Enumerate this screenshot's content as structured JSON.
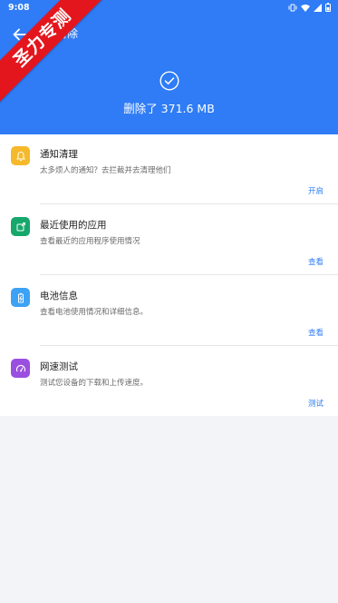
{
  "status_bar": {
    "time": "9:08"
  },
  "header": {
    "title": "清除",
    "result": "删除了 371.6 MB"
  },
  "ribbon": {
    "text": "圣力专测"
  },
  "items": [
    {
      "title": "通知清理",
      "desc": "太多烦人的通知？去拦截并去清理他们",
      "action": "开启",
      "icon": "bell-icon",
      "color": "#f5b92b"
    },
    {
      "title": "最近使用的应用",
      "desc": "查看最近的应用程序使用情况",
      "action": "查看",
      "icon": "recent-apps-icon",
      "color": "#16a76b"
    },
    {
      "title": "电池信息",
      "desc": "查看电池使用情况和详细信息。",
      "action": "查看",
      "icon": "battery-icon",
      "color": "#3ea2f4"
    },
    {
      "title": "网速测试",
      "desc": "测试您设备的下载和上传速度。",
      "action": "测试",
      "icon": "speedometer-icon",
      "color": "#9a4fe0"
    }
  ],
  "colors": {
    "primary": "#2f7cf6",
    "ribbon": "#e4161d",
    "background": "#f3f4f8"
  }
}
